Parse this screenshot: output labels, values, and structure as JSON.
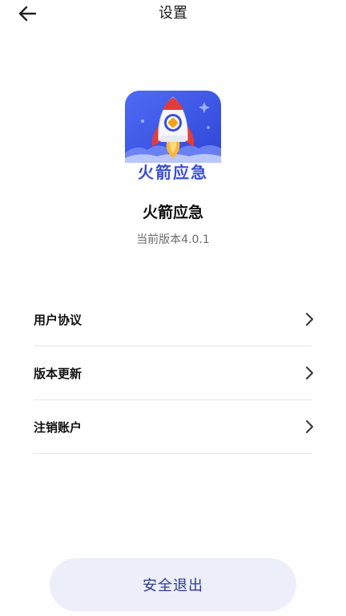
{
  "header": {
    "title": "设置",
    "back_icon": "arrow-left-icon"
  },
  "app": {
    "logo_text": "火箭应急",
    "name": "火箭应急",
    "version_text": "当前版本4.0.1"
  },
  "menu": {
    "items": [
      {
        "label": "用户协议",
        "icon": "chevron-right-icon"
      },
      {
        "label": "版本更新",
        "icon": "chevron-right-icon"
      },
      {
        "label": "注销账户",
        "icon": "chevron-right-icon"
      }
    ]
  },
  "footer": {
    "logout_label": "安全退出"
  },
  "colors": {
    "logo_blue": "#3b4fd0",
    "logout_bg": "#eceef9",
    "logout_text": "#2e3a8c",
    "divider": "#e6e6e6"
  }
}
